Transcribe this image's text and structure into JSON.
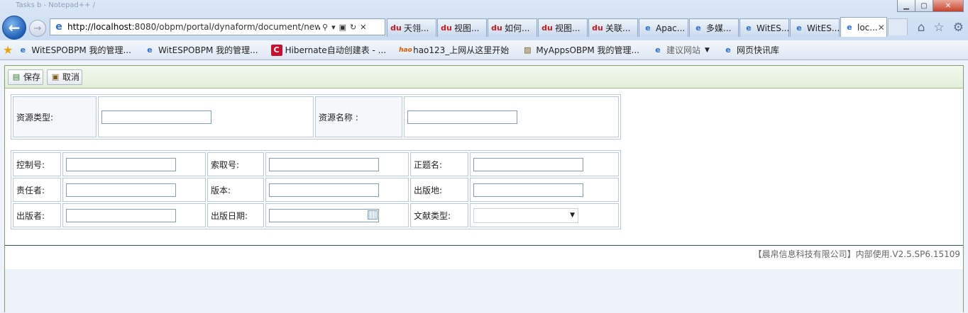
{
  "browser": {
    "title_ghost": "Tasks  b - Notepad++  /",
    "window_buttons": [
      "minimize",
      "maximize",
      "close"
    ],
    "address": {
      "url_host": "http://localhost",
      "url_rest": ":8080/obpm/portal/dynaform/document/newW",
      "search_icon": "search-icon",
      "refresh_icon": "refresh-icon",
      "stop_icon": "stop-icon"
    },
    "tabs": [
      {
        "label": "天翎...",
        "icon": "baidu-icon"
      },
      {
        "label": "视图...",
        "icon": "baidu-icon"
      },
      {
        "label": "如何...",
        "icon": "baidu-icon"
      },
      {
        "label": "视图...",
        "icon": "baidu-icon"
      },
      {
        "label": "关联...",
        "icon": "baidu-icon"
      },
      {
        "label": "Apac...",
        "icon": "ie-page-icon"
      },
      {
        "label": "多媒...",
        "icon": "ie-page-icon"
      },
      {
        "label": "WitES...",
        "icon": "ie-page-icon"
      },
      {
        "label": "WitES...",
        "icon": "ie-page-icon"
      },
      {
        "label": "loc...",
        "icon": "ie-page-icon",
        "active": true
      }
    ],
    "favorites": [
      {
        "label": "WitESPOBPM 我的管理...",
        "icon": "ie-page-icon"
      },
      {
        "label": "WitESPOBPM 我的管理...",
        "icon": "ie-page-icon"
      },
      {
        "label": "Hibernate自动创建表 - ...",
        "icon": "c-icon"
      },
      {
        "label": "hao123_上网从这里开始",
        "icon": "hao123-icon"
      },
      {
        "label": "MyAppsOBPM 我的管理...",
        "icon": "picture-icon"
      },
      {
        "label": "建议网站",
        "icon": "ie-page-icon"
      },
      {
        "label": "网页快讯库",
        "icon": "ie-page-icon"
      }
    ]
  },
  "toolbar": {
    "save_label": "保存",
    "cancel_label": "取消"
  },
  "form": {
    "resource_type_label": "资源类型:",
    "resource_name_label": "资源名称 :",
    "control_no_label": "控制号:",
    "call_no_label": "索取号:",
    "title_label": "正题名:",
    "responsible_label": "责任者:",
    "edition_label": "版本:",
    "pub_place_label": "出版地:",
    "publisher_label": "出版者:",
    "pub_date_label": "出版日期:",
    "doc_type_label": "文献类型:",
    "values": {
      "resource_type": "",
      "resource_name": "",
      "control_no": "",
      "call_no": "",
      "title": "",
      "responsible": "",
      "edition": "",
      "pub_place": "",
      "publisher": "",
      "pub_date": "",
      "doc_type": ""
    }
  },
  "footer": {
    "text": "【晨帛信息科技有限公司】内部使用.V2.5.SP6.15109"
  }
}
